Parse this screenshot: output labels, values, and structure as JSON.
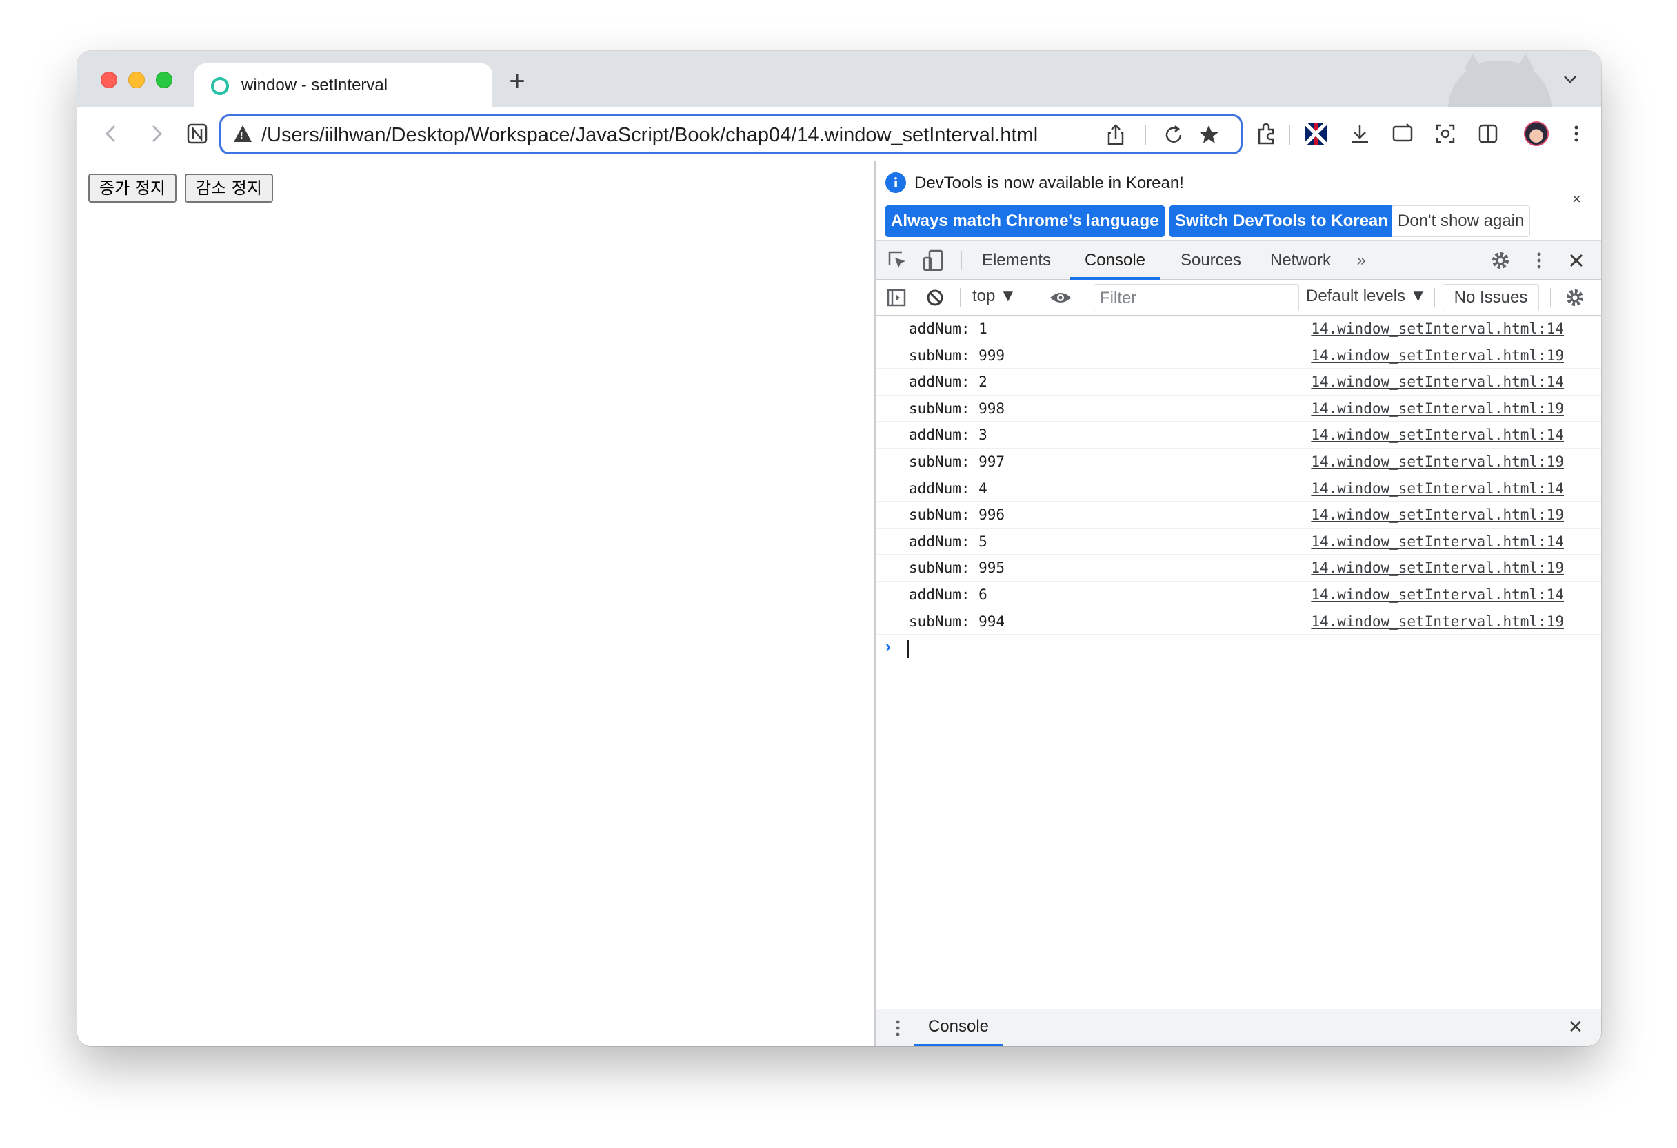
{
  "browser": {
    "tab_title": "window - setInterval",
    "new_tab": "+",
    "url": "/Users/iilhwan/Desktop/Workspace/JavaScript/Book/chap04/14.window_setInterval.html"
  },
  "page": {
    "buttons": [
      "증가 정지",
      "감소 정지"
    ]
  },
  "devtools": {
    "infobar": {
      "message": "DevTools is now available in Korean!",
      "always_match": "Always match Chrome's language",
      "switch": "Switch DevTools to Korean",
      "dont_show": "Don't show again",
      "close": "×"
    },
    "tabs": [
      "Elements",
      "Console",
      "Sources",
      "Network"
    ],
    "active_tab": "Console",
    "more_tabs": "»",
    "filterbar": {
      "context": "top ▼",
      "filter_placeholder": "Filter",
      "levels": "Default levels ▼",
      "issues": "No Issues"
    },
    "console_logs": [
      {
        "msg": "addNum: 1",
        "src": "14.window_setInterval.html:14"
      },
      {
        "msg": "subNum: 999",
        "src": "14.window_setInterval.html:19"
      },
      {
        "msg": "addNum: 2",
        "src": "14.window_setInterval.html:14"
      },
      {
        "msg": "subNum: 998",
        "src": "14.window_setInterval.html:19"
      },
      {
        "msg": "addNum: 3",
        "src": "14.window_setInterval.html:14"
      },
      {
        "msg": "subNum: 997",
        "src": "14.window_setInterval.html:19"
      },
      {
        "msg": "addNum: 4",
        "src": "14.window_setInterval.html:14"
      },
      {
        "msg": "subNum: 996",
        "src": "14.window_setInterval.html:19"
      },
      {
        "msg": "addNum: 5",
        "src": "14.window_setInterval.html:14"
      },
      {
        "msg": "subNum: 995",
        "src": "14.window_setInterval.html:19"
      },
      {
        "msg": "addNum: 6",
        "src": "14.window_setInterval.html:14"
      },
      {
        "msg": "subNum: 994",
        "src": "14.window_setInterval.html:19"
      }
    ],
    "prompt": "›",
    "drawer": {
      "tab": "Console",
      "close": "✕"
    }
  },
  "colors": {
    "accent": "#1a73e8",
    "favicon": "#27c1a6",
    "omnibox_border": "#3c73e0"
  }
}
